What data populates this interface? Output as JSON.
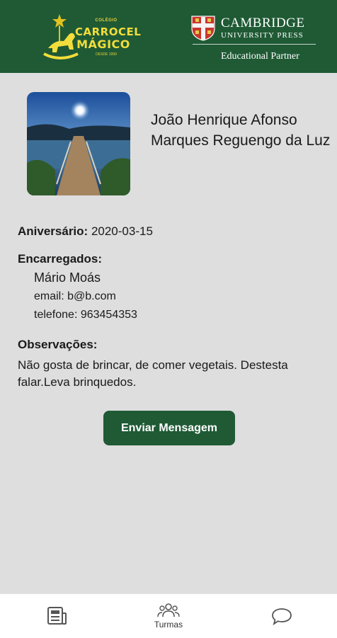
{
  "header": {
    "school_logo": {
      "line_small": "COLÉGIO",
      "line1": "CARROCEL",
      "line2": "MÁGICO",
      "since": "DESDE 1999"
    },
    "partner": {
      "title": "CAMBRIDGE",
      "subtitle": "UNIVERSITY PRESS",
      "tagline": "Educational Partner"
    }
  },
  "student": {
    "name": "João Henrique Afonso Marques Reguengo da Luz",
    "birthday_label": "Aniversário:",
    "birthday_value": "2020-03-15",
    "guardians_label": "Encarregados:",
    "guardian": {
      "name": "Mário Moás",
      "email": "email: b@b.com",
      "phone": "telefone: 963454353"
    },
    "notes_label": "Observações:",
    "notes": "Não gosta de brincar, de comer vegetais. Destesta falar.Leva brinquedos."
  },
  "actions": {
    "send_message": "Enviar Mensagem"
  },
  "bottom_nav": {
    "items": [
      {
        "icon": "news-icon",
        "label": ""
      },
      {
        "icon": "group-icon",
        "label": "Turmas"
      },
      {
        "icon": "chat-icon",
        "label": ""
      }
    ]
  },
  "colors": {
    "brand_green": "#1f5a35",
    "background": "#dedede",
    "logo_yellow": "#f2dd3b"
  }
}
